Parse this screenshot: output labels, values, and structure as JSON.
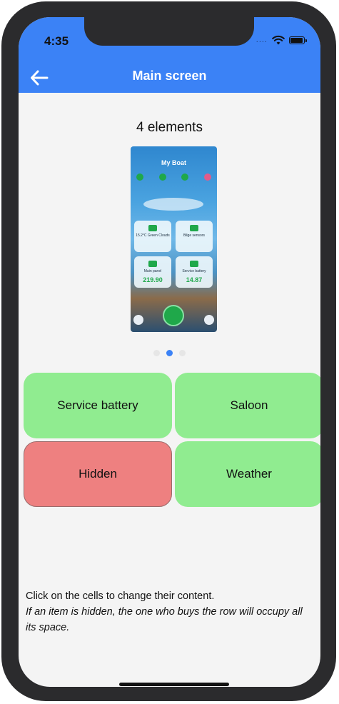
{
  "status_bar": {
    "time": "4:35",
    "signal_dots": "....",
    "wifi_icon": "wifi-icon",
    "battery_icon": "battery-icon"
  },
  "nav": {
    "back_icon": "arrow-left-icon",
    "title": "Main screen"
  },
  "main": {
    "element_count": "4 elements",
    "preview": {
      "title": "My Boat",
      "cards": [
        {
          "label": "15.2°C Green Clouds",
          "value": ""
        },
        {
          "label": "Bilge sensors",
          "value": ""
        },
        {
          "label": "Main panel",
          "value": "219.90"
        },
        {
          "label": "Service battery",
          "value": "14.87"
        }
      ]
    },
    "pager": {
      "total": 3,
      "active": 1
    },
    "cells": [
      {
        "label": "Service battery",
        "state": "visible",
        "color": "#90ec90"
      },
      {
        "label": "Saloon",
        "state": "visible",
        "color": "#90ec90"
      },
      {
        "label": "Hidden",
        "state": "hidden",
        "color": "#ee8080"
      },
      {
        "label": "Weather",
        "state": "visible",
        "color": "#90ec90"
      }
    ]
  },
  "instructions": {
    "line1": "Click on the cells to change their content.",
    "line2": "If an item is hidden, the one who buys the row will occupy all its space."
  },
  "colors": {
    "header": "#3b82f6",
    "cell_green": "#90ec90",
    "cell_red": "#ee8080"
  }
}
